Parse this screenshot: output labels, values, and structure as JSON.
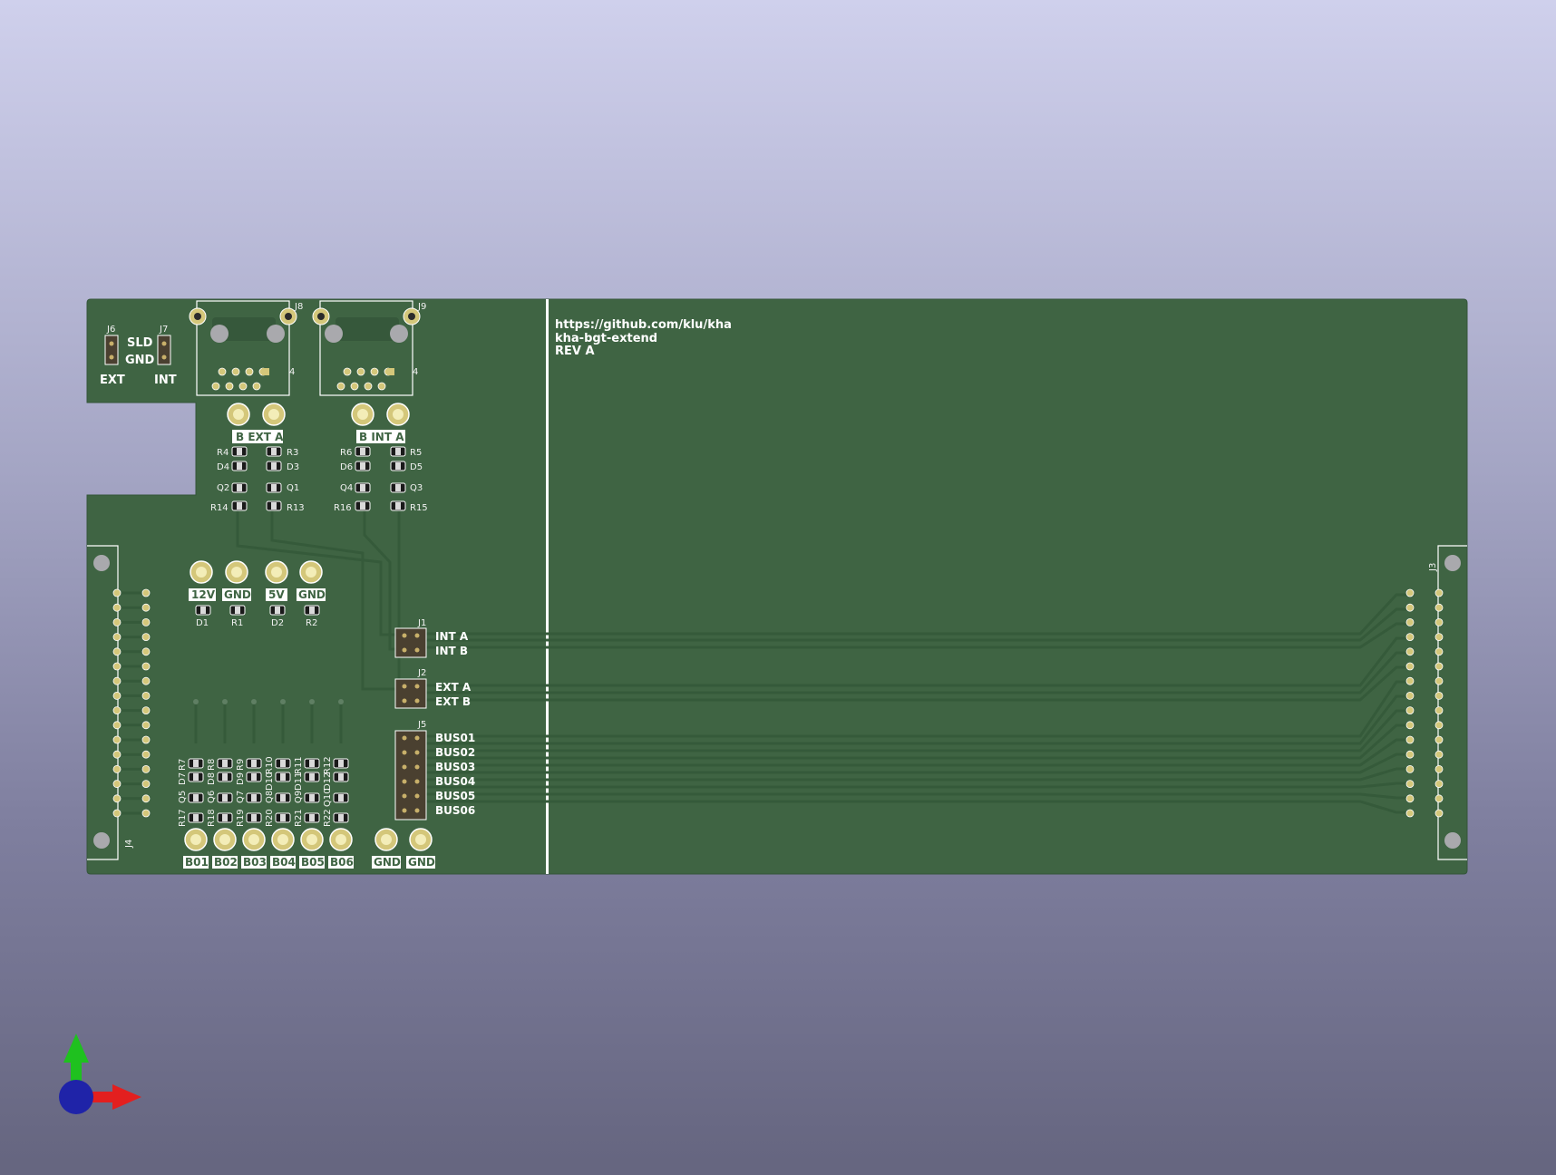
{
  "viewer": {
    "background_top": "#cfd0ec",
    "background_bottom": "#65657f",
    "axes_icon": {
      "x_color": "#e31f1f",
      "y_color": "#1fc11f",
      "z_color": "#1f23a8"
    }
  },
  "board": {
    "colors": {
      "soldermask": "#3f6443",
      "silkscreen": "#ffffff",
      "copper_pad": "#c8b06a"
    },
    "silkscreen_text": {
      "url": "https://github.com/klu/kha",
      "project": "kha-bgt-extend",
      "revision": "REV A"
    },
    "top_left": {
      "j6_ref": "J6",
      "j7_ref": "J7",
      "sld_label": "SLD",
      "gnd_label": "GND",
      "ext_label": "EXT",
      "int_label": "INT"
    },
    "db9": [
      {
        "ref": "J8",
        "pin1": "4",
        "test_label": "B EXT A"
      },
      {
        "ref": "J9",
        "pin1": "4",
        "test_label": "B INT A"
      }
    ],
    "ext_components": {
      "left": [
        "R4",
        "D4",
        "Q2",
        "R14"
      ],
      "right": [
        "R3",
        "D3",
        "Q1",
        "R13"
      ]
    },
    "int_components": {
      "left": [
        "R6",
        "D6",
        "Q4",
        "R16"
      ],
      "right": [
        "R5",
        "D5",
        "Q3",
        "R15"
      ]
    },
    "power": {
      "labels": [
        "12V",
        "GND",
        "5V",
        "GND"
      ],
      "refs": [
        "D1",
        "R1",
        "D2",
        "R2"
      ]
    },
    "headers": [
      {
        "ref": "J1",
        "labels": [
          "INT A",
          "INT B"
        ]
      },
      {
        "ref": "J2",
        "labels": [
          "EXT A",
          "EXT B"
        ]
      },
      {
        "ref": "J5",
        "labels": [
          "BUS01",
          "BUS02",
          "BUS03",
          "BUS04",
          "BUS05",
          "BUS06"
        ]
      }
    ],
    "bus_drivers": {
      "d_refs": [
        "D7",
        "D8",
        "D9",
        "D10",
        "D11",
        "D12"
      ],
      "r_upper": [
        "R7",
        "R8",
        "R9",
        "R10",
        "R11",
        "R12"
      ],
      "q_refs": [
        "Q5",
        "Q6",
        "Q7",
        "Q8",
        "Q9",
        "Q10"
      ],
      "r_lower": [
        "R17",
        "R18",
        "R19",
        "R20",
        "R21",
        "R22"
      ]
    },
    "bottom_testpoints": [
      "B01",
      "B02",
      "B03",
      "B04",
      "B05",
      "B06",
      "GND",
      "GND"
    ],
    "edge_connectors": {
      "left": "J4",
      "right": "J3"
    }
  }
}
